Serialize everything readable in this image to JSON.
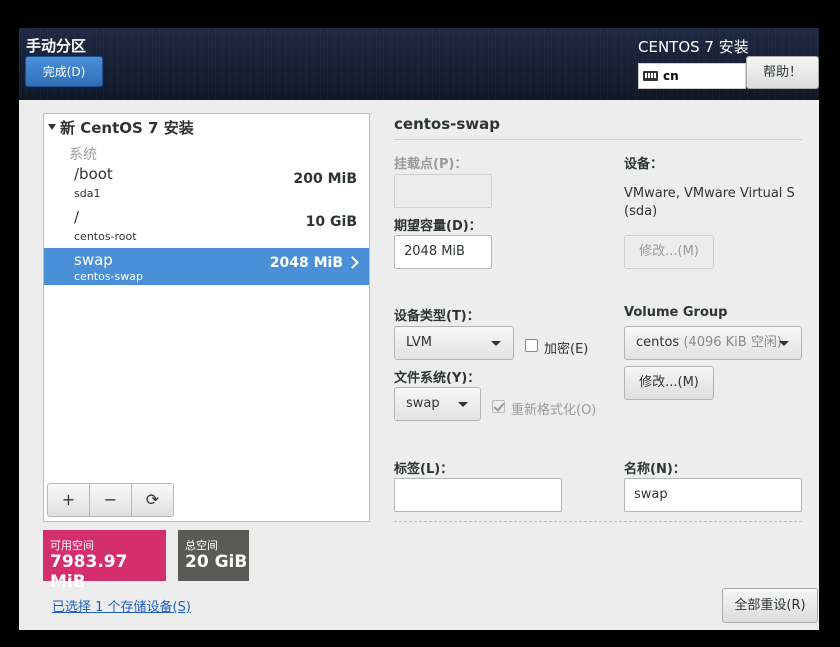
{
  "header": {
    "spoke_title": "手动分区",
    "done_label": "完成(D)",
    "product_title": "CENTOS 7 安装",
    "keyboard_layout": "cn",
    "help_label": "帮助！"
  },
  "partitions": {
    "root_label": "新 CentOS 7 安装",
    "section_label": "系统",
    "items": [
      {
        "mount": "/boot",
        "device": "sda1",
        "size": "200 MiB",
        "selected": false
      },
      {
        "mount": "/",
        "device": "centos-root",
        "size": "10 GiB",
        "selected": false
      },
      {
        "mount": "swap",
        "device": "centos-swap",
        "size": "2048 MiB",
        "selected": true
      }
    ],
    "toolbar": {
      "add": "+",
      "remove": "−",
      "refresh": "⟳"
    }
  },
  "space": {
    "available_label": "可用空间",
    "available_value": "7983.97 MiB",
    "total_label": "总空间",
    "total_value": "20 GiB",
    "available_color": "#d52e6f",
    "total_color": "#5a5a57"
  },
  "storage_link": "已选择 1 个存储设备(S)",
  "details": {
    "title": "centos-swap",
    "mount_point_label": "挂载点(P)：",
    "mount_point_value": "",
    "desired_capacity_label": "期望容量(D)：",
    "desired_capacity_value": "2048 MiB",
    "device_label": "设备：",
    "device_value_line1": "VMware, VMware Virtual S",
    "device_value_line2": "(sda)",
    "device_modify_label": "修改...(M)",
    "device_type_label": "设备类型(T)：",
    "device_type_value": "LVM",
    "encrypt_label": "加密(E)",
    "volume_group_label": "Volume Group",
    "volume_group_value": "centos",
    "volume_group_free": "(4096 KiB 空闲)",
    "vg_modify_label": "修改...(M)",
    "filesystem_label": "文件系统(Y)：",
    "filesystem_value": "swap",
    "reformat_label": "重新格式化(O)",
    "tag_label": "标签(L)：",
    "tag_value": "",
    "name_label": "名称(N)：",
    "name_value": "swap",
    "reset_all_label": "全部重设(R)"
  }
}
